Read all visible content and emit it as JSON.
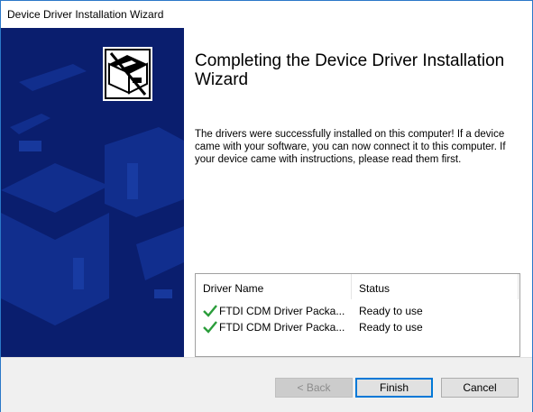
{
  "window": {
    "title": "Device Driver Installation Wizard"
  },
  "main": {
    "heading": "Completing the Device Driver Installation Wizard",
    "description": "The drivers were successfully installed on this computer! If a device came with your software, you can now connect it to this computer. If your device came with instructions, please read them first."
  },
  "driver_list": {
    "columns": [
      "Driver Name",
      "Status"
    ],
    "rows": [
      {
        "icon": "checkmark-icon",
        "name": "FTDI CDM Driver Packa...",
        "status": "Ready to use"
      },
      {
        "icon": "checkmark-icon",
        "name": "FTDI CDM Driver Packa...",
        "status": "Ready to use"
      }
    ]
  },
  "buttons": {
    "back": "< Back",
    "finish": "Finish",
    "cancel": "Cancel"
  },
  "colors": {
    "side_panel": "#0a1e6e",
    "check": "#2a9d3a",
    "accent": "#0078d7"
  }
}
